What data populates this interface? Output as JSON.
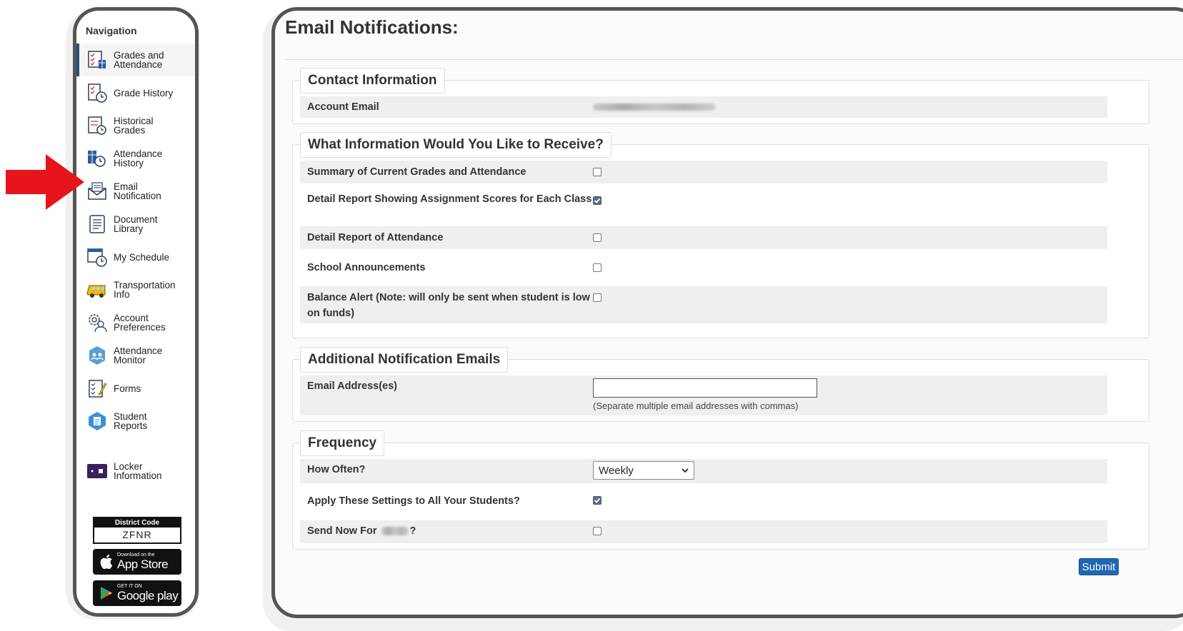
{
  "nav": {
    "title": "Navigation",
    "items": [
      {
        "label_1": "Grades and",
        "label_2": "Attendance",
        "icon": "grades-attendance-icon",
        "active": true
      },
      {
        "label_1": "Grade History",
        "label_2": "",
        "icon": "grade-history-icon"
      },
      {
        "label_1": "Historical",
        "label_2": "Grades",
        "icon": "historical-grades-icon"
      },
      {
        "label_1": "Attendance",
        "label_2": "History",
        "icon": "attendance-history-icon"
      },
      {
        "label_1": "Email",
        "label_2": "Notification",
        "icon": "email-notification-icon"
      },
      {
        "label_1": "Document",
        "label_2": "Library",
        "icon": "document-library-icon"
      },
      {
        "label_1": "My Schedule",
        "label_2": "",
        "icon": "schedule-icon"
      },
      {
        "label_1": "Transportation",
        "label_2": "Info",
        "icon": "school-bus-icon"
      },
      {
        "label_1": "Account",
        "label_2": "Preferences",
        "icon": "account-preferences-icon"
      },
      {
        "label_1": "Attendance",
        "label_2": "Monitor",
        "icon": "attendance-monitor-icon"
      },
      {
        "label_1": "Forms",
        "label_2": "",
        "icon": "forms-icon"
      },
      {
        "label_1": "Student",
        "label_2": "Reports",
        "icon": "student-reports-icon"
      },
      {
        "label_1": "Locker",
        "label_2": "Information",
        "icon": "locker-icon"
      }
    ],
    "district_code_label": "District Code",
    "district_code": "ZFNR",
    "app_store_small": "Download on the",
    "app_store_big": "App Store",
    "google_play_small": "GET IT ON",
    "google_play_big": "Google play"
  },
  "main": {
    "title": "Email Notifications:",
    "contact": {
      "legend": "Contact Information",
      "account_email_label": "Account Email"
    },
    "receive": {
      "legend": "What Information Would You Like to Receive?",
      "options": [
        {
          "label": "Summary of Current Grades and Attendance",
          "checked": false
        },
        {
          "label": "Detail Report Showing Assignment Scores for Each Class",
          "checked": true
        },
        {
          "label": "Detail Report of Attendance",
          "checked": false
        },
        {
          "label": "School Announcements",
          "checked": false
        },
        {
          "label": "Balance Alert (Note: will only be sent when student is low on funds)",
          "checked": false
        }
      ]
    },
    "additional": {
      "legend": "Additional Notification Emails",
      "email_label": "Email Address(es)",
      "email_value": "",
      "help": "(Separate multiple email addresses with commas)"
    },
    "frequency": {
      "legend": "Frequency",
      "how_often_label": "How Often?",
      "how_often_value": "Weekly",
      "apply_label": "Apply These Settings to All Your Students?",
      "apply_checked": true,
      "send_now_prefix": "Send Now For",
      "send_now_suffix": "?",
      "send_now_checked": false
    },
    "submit_label": "Submit"
  },
  "colors": {
    "accent": "#1f67b1",
    "arrow": "#e8141b",
    "row_shade": "#efefef",
    "frame": "#555555"
  }
}
